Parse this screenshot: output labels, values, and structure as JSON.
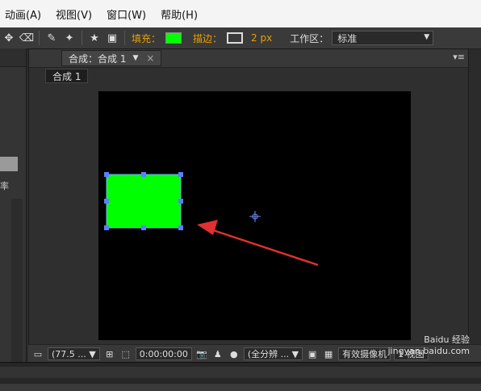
{
  "menubar": {
    "items": [
      "动画(A)",
      "视图(V)",
      "窗口(W)",
      "帮助(H)"
    ]
  },
  "toolbar": {
    "fill_label": "填充：",
    "fill_color": "#00ff00",
    "stroke_label": "描边：",
    "stroke_width": "2 px",
    "workspace_label": "工作区：",
    "workspace_value": "标准"
  },
  "left_panel": {
    "header_text": "率"
  },
  "comp_panel": {
    "tab_label": "合成：合成 1",
    "breadcrumb": "合成 1"
  },
  "shape": {
    "fill": "#00ff00",
    "selected": true
  },
  "viewer_bar": {
    "zoom": "(77.5 ...",
    "timecode": "0:00:00:00",
    "resolution": "(全分辨 ...",
    "camera": "有效摄像机",
    "views": "1 视图"
  },
  "watermark": {
    "brand": "Baidu 经验",
    "url": "jingyan.baidu.com"
  }
}
